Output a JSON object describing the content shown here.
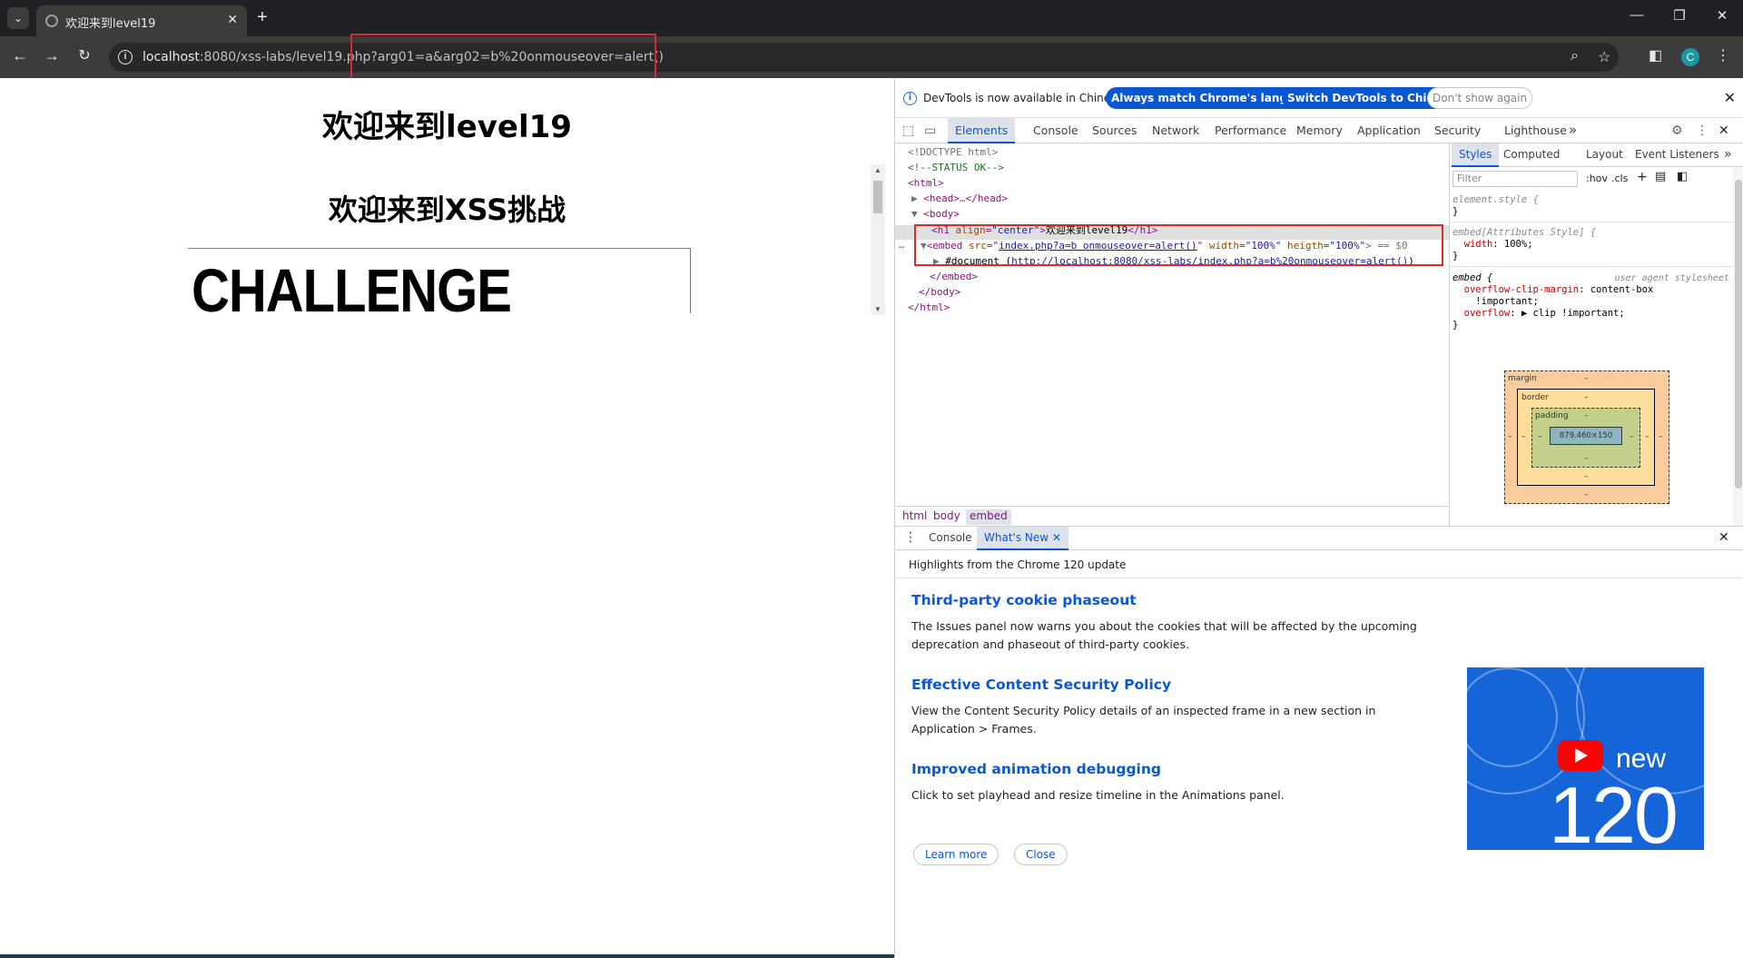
{
  "browser": {
    "tab_title": "欢迎来到level19",
    "url_host": "localhost",
    "url_rest": ":8080/xss-labs/level19.php?arg01=a&arg02=b%20onmouseover=alert()",
    "profile_initial": "C",
    "accent": "#1a9aa0"
  },
  "page": {
    "heading1": "欢迎来到level19",
    "heading2": "欢迎来到XSS挑战",
    "challenge_text": "CHALLENGE ACCEPTED"
  },
  "devtools": {
    "notice": {
      "message": "DevTools is now available in Chinese!",
      "btn_match": "Always match Chrome's language",
      "btn_switch": "Switch DevTools to Chinese",
      "btn_dismiss": "Don't show again"
    },
    "tabs": [
      "Elements",
      "Console",
      "Sources",
      "Network",
      "Performance",
      "Memory",
      "Application",
      "Security",
      "Lighthouse"
    ],
    "more_tabs": "»",
    "elements": {
      "doctype": "<!DOCTYPE html>",
      "comment": "<!--STATUS OK-->",
      "html_open": "<html>",
      "head_open": "<head>",
      "head_ellipsis": "…",
      "head_close": "</head>",
      "body_open": "<body>",
      "h1_open": "<h1 ",
      "h1_attr": "align",
      "h1_val": "\"center\"",
      "h1_text": "欢迎来到level19",
      "h1_close": "</h1>",
      "embed_open": "<embed ",
      "embed_src_attr": "src",
      "embed_src_val": "index.php?a=b onmouseover=alert()",
      "embed_width_attr": "width",
      "embed_width_val": "\"100%\"",
      "embed_heigth_attr": "heigth",
      "embed_heigth_val": "\"100%\"",
      "embed_tail": "> == $0",
      "document_label": "#document (",
      "document_link": "http://localhost:8080/xss-labs/index.php?a=b%20onmouseover=alert()",
      "document_close": ")",
      "embed_close": "</embed>",
      "body_close": "</body>",
      "html_close": "</html>"
    },
    "breadcrumbs": [
      "html",
      "body",
      "embed"
    ],
    "styles": {
      "tabs": [
        "Styles",
        "Computed",
        "Layout",
        "Event Listeners"
      ],
      "filter_placeholder": "Filter",
      "hov": ":hov",
      "cls": ".cls",
      "rule1_selector": "element.style {",
      "rule1_close": "}",
      "rule2_selector": "embed[Attributes Style] {",
      "rule2_prop": "width",
      "rule2_value": ": 100%;",
      "rule2_close": "}",
      "rule3_selector": "embed {",
      "rule3_source": "user agent stylesheet",
      "rule3_prop1": "overflow-clip-margin",
      "rule3_val1": ": content-box",
      "rule3_val1b": "!important;",
      "rule3_prop2": "overflow",
      "rule3_val2": ": ▶ clip !important;",
      "rule3_close": "}"
    },
    "boxmodel": {
      "margin_label": "margin",
      "border_label": "border",
      "padding_label": "padding",
      "dash": "–",
      "content_size": "879.460×150"
    },
    "drawer": {
      "tabs": [
        "Console",
        "What's New"
      ],
      "subtitle": "Highlights from the Chrome 120 update",
      "items": [
        {
          "title": "Third-party cookie phaseout",
          "body": "The Issues panel now warns you about the cookies that will be affected by the upcoming deprecation and phaseout of third-party cookies."
        },
        {
          "title": "Effective Content Security Policy",
          "body": "View the Content Security Policy details of an inspected frame in a new section in Application > Frames."
        },
        {
          "title": "Improved animation debugging",
          "body": "Click to set playhead and resize timeline in the Animations panel."
        }
      ],
      "learn_more": "Learn more",
      "close": "Close",
      "promo_new": "new",
      "promo_version": "120"
    }
  }
}
